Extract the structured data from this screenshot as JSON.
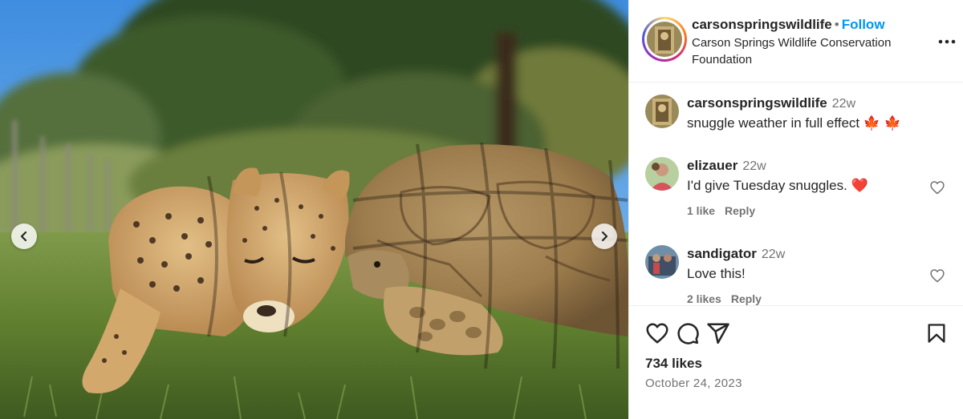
{
  "post": {
    "author": {
      "username": "carsonspringswildlife",
      "separator": "•",
      "follow_label": "Follow",
      "subtitle": "Carson Springs Wildlife Conservation Foundation"
    },
    "caption": {
      "username": "carsonspringswildlife",
      "time": "22w",
      "text": "snuggle weather in full effect 🍁 🍁"
    },
    "comments": [
      {
        "username": "elizauer",
        "time": "22w",
        "text": "I'd give Tuesday snuggles. ❤️",
        "likes": "1 like",
        "reply": "Reply"
      },
      {
        "username": "sandigator",
        "time": "22w",
        "text": "Love this!",
        "likes": "2 likes",
        "reply": "Reply"
      }
    ],
    "like_count": "734 likes",
    "date": "October 24, 2023"
  },
  "icons": {
    "prev": "chevron-left-icon",
    "next": "chevron-right-icon",
    "more": "more-options-icon",
    "like": "heart-icon",
    "comment": "comment-icon",
    "share": "share-icon",
    "save": "bookmark-icon"
  },
  "colors": {
    "accent": "#0095f6",
    "muted": "#737373",
    "text": "#262626",
    "divider": "#efefef"
  }
}
